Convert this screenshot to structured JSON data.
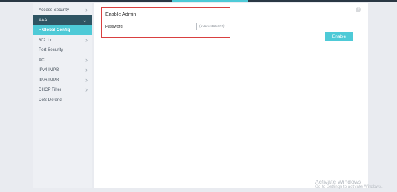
{
  "sidebar": {
    "items": [
      {
        "label": "Access Security",
        "chevron": "›"
      },
      {
        "label": "AAA",
        "chevron": "⌄"
      },
      {
        "label": "• Global Config"
      },
      {
        "label": "802.1x",
        "chevron": "›"
      },
      {
        "label": "Port Security"
      },
      {
        "label": "ACL",
        "chevron": "›"
      },
      {
        "label": "IPv4 IMPB",
        "chevron": "›"
      },
      {
        "label": "IPv6 IMPB",
        "chevron": "›"
      },
      {
        "label": "DHCP Filter",
        "chevron": "›"
      },
      {
        "label": "DoS Defend"
      }
    ]
  },
  "main": {
    "help_icon": "?",
    "panel_title": "Enable Admin",
    "password_label": "Password",
    "password_value": "",
    "password_hint": "(1-31 characters)",
    "enable_button": "Enable"
  },
  "watermark": {
    "line1": "Activate Windows",
    "line2": "Go to Settings to activate Windows."
  },
  "colors": {
    "accent": "#4ecad7",
    "active": "#2f5563",
    "highlight_border": "#d94040"
  }
}
